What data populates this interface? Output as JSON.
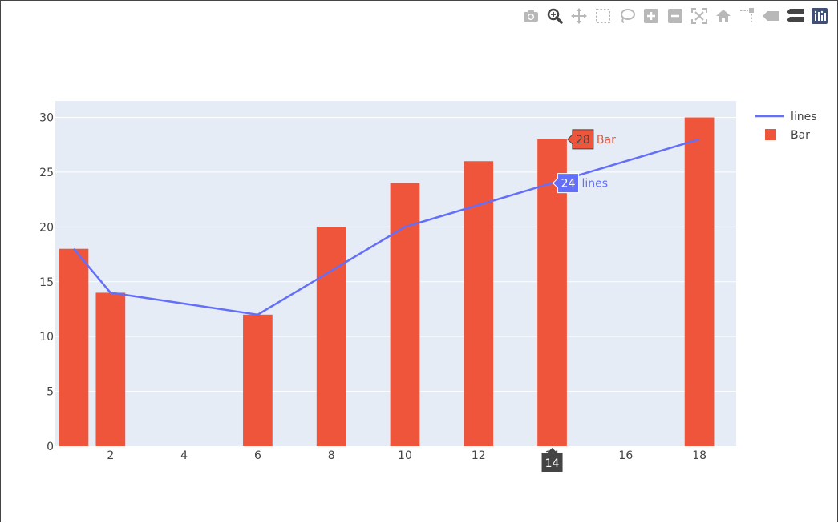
{
  "modebar": {
    "buttons": [
      {
        "name": "camera-icon",
        "title": "Download plot as a png"
      },
      {
        "name": "zoom-icon",
        "title": "Zoom"
      },
      {
        "name": "pan-icon",
        "title": "Pan"
      },
      {
        "name": "box-select-icon",
        "title": "Box Select"
      },
      {
        "name": "lasso-select-icon",
        "title": "Lasso Select"
      },
      {
        "name": "zoom-in-icon",
        "title": "Zoom in"
      },
      {
        "name": "zoom-out-icon",
        "title": "Zoom out"
      },
      {
        "name": "autoscale-icon",
        "title": "Autoscale"
      },
      {
        "name": "reset-axes-icon",
        "title": "Reset axes"
      },
      {
        "name": "spike-lines-icon",
        "title": "Toggle Spike Lines"
      },
      {
        "name": "hover-closest-icon",
        "title": "Show closest data on hover"
      },
      {
        "name": "hover-compare-icon",
        "title": "Compare data on hover"
      },
      {
        "name": "plotly-logo-icon",
        "title": "Produced with Plotly"
      }
    ]
  },
  "chart_data": {
    "type": "bar",
    "title": "",
    "xlabel": "",
    "ylabel": "",
    "xlim": [
      0.5,
      19
    ],
    "ylim": [
      0,
      31.5
    ],
    "xticks": [
      2,
      4,
      6,
      8,
      10,
      12,
      14,
      16,
      18
    ],
    "yticks": [
      0,
      5,
      10,
      15,
      20,
      25,
      30
    ],
    "grid": true,
    "legend_position": "top-right",
    "series": [
      {
        "name": "lines",
        "kind": "line",
        "color": "#636efa",
        "x": [
          1,
          2,
          6,
          8,
          10,
          12,
          14,
          18
        ],
        "y": [
          18,
          14,
          12,
          16,
          20,
          22,
          24,
          28
        ]
      },
      {
        "name": "Bar",
        "kind": "bar",
        "color": "#ef553b",
        "x": [
          1,
          2,
          6,
          8,
          10,
          12,
          14,
          18
        ],
        "y": [
          18,
          14,
          12,
          20,
          24,
          26,
          28,
          30
        ]
      }
    ],
    "hover": {
      "x": 14,
      "x_label": "14",
      "labels": [
        {
          "series": "Bar",
          "value": "28",
          "name": "Bar"
        },
        {
          "series": "lines",
          "value": "24",
          "name": "lines"
        }
      ]
    }
  },
  "colors": {
    "plot_bg": "#e5ecf6",
    "grid": "#ffffff",
    "text": "#444444",
    "modebar_icon": "#b8b8b8",
    "modebar_active": "#444444",
    "plotly_logo_bg": "#3f4f75"
  }
}
